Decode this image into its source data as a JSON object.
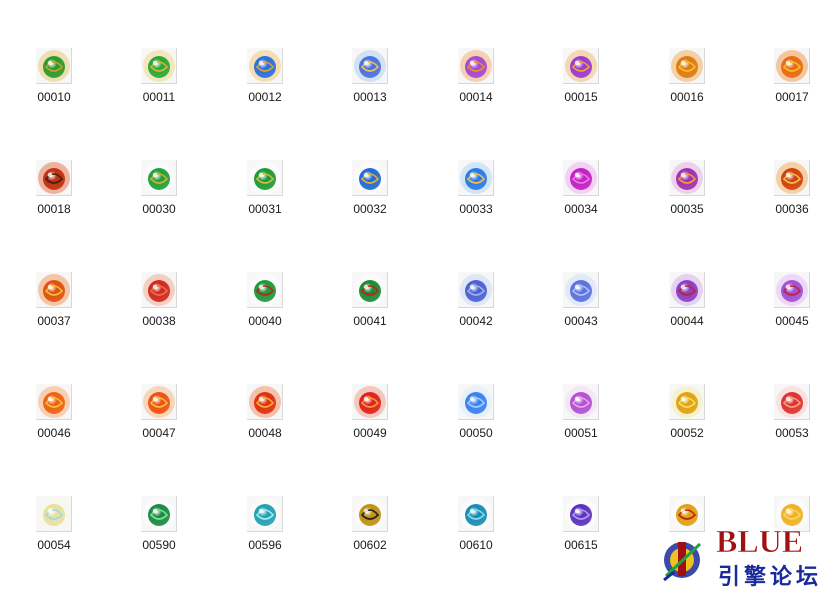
{
  "files": [
    {
      "name": "00010",
      "icon": "green-scarab-orb-icon",
      "c1": "#2a9a2a",
      "c2": "#c9a030",
      "glow": "#e0c060"
    },
    {
      "name": "00011",
      "icon": "green-gold-orb-icon",
      "c1": "#26a83a",
      "c2": "#e0b030",
      "glow": "#f0d070"
    },
    {
      "name": "00012",
      "icon": "blue-winged-orb-icon",
      "c1": "#2a6ee0",
      "c2": "#e0a030",
      "glow": "#f0c060"
    },
    {
      "name": "00013",
      "icon": "blue-winged-orb-icon",
      "c1": "#4a70e0",
      "c2": "#f0c050",
      "glow": "#a0c8f0"
    },
    {
      "name": "00014",
      "icon": "violet-flame-orb-icon",
      "c1": "#a04ad0",
      "c2": "#f08a30",
      "glow": "#f6a060"
    },
    {
      "name": "00015",
      "icon": "purple-flame-orb-icon",
      "c1": "#9a3ad0",
      "c2": "#f0a030",
      "glow": "#f0b060"
    },
    {
      "name": "00016",
      "icon": "gold-sun-orb-icon",
      "c1": "#e07a10",
      "c2": "#f6c030",
      "glow": "#f0a040"
    },
    {
      "name": "00017",
      "icon": "gold-sun-orb-icon",
      "c1": "#e86a10",
      "c2": "#f6c030",
      "glow": "#f08a30"
    },
    {
      "name": "00018",
      "icon": "dark-flame-orb-icon",
      "c1": "#c03010",
      "c2": "#402010",
      "glow": "#e06030"
    },
    {
      "name": "00030",
      "icon": "green-orb-icon",
      "c1": "#1ea03a",
      "c2": "#d0b030",
      "glow": "#ffffff"
    },
    {
      "name": "00031",
      "icon": "green-orb-icon",
      "c1": "#1c9a36",
      "c2": "#d8b840",
      "glow": "#ffffff"
    },
    {
      "name": "00032",
      "icon": "blue-orb-icon",
      "c1": "#1e6ad8",
      "c2": "#e0b030",
      "glow": "#ffffff"
    },
    {
      "name": "00033",
      "icon": "blue-swirl-orb-icon",
      "c1": "#2a7ae6",
      "c2": "#f0c050",
      "glow": "#a0d0f6"
    },
    {
      "name": "00034",
      "icon": "magenta-orb-icon",
      "c1": "#c020c0",
      "c2": "#f070f0",
      "glow": "#f0a0f0"
    },
    {
      "name": "00035",
      "icon": "purple-dotted-orb-icon",
      "c1": "#a030b0",
      "c2": "#f0a030",
      "glow": "#e0a0e0"
    },
    {
      "name": "00036",
      "icon": "orange-flame-orb-icon",
      "c1": "#d04010",
      "c2": "#f0c040",
      "glow": "#f0a040"
    },
    {
      "name": "00037",
      "icon": "fire-orb-icon",
      "c1": "#e05010",
      "c2": "#f6c030",
      "glow": "#f08a40"
    },
    {
      "name": "00038",
      "icon": "red-flame-orb-icon",
      "c1": "#d02820",
      "c2": "#f07040",
      "glow": "#f0a080"
    },
    {
      "name": "00040",
      "icon": "green-jade-pendant-icon",
      "c1": "#1a9a3a",
      "c2": "#c02020",
      "glow": "#ffffff"
    },
    {
      "name": "00041",
      "icon": "green-jade-ring-icon",
      "c1": "#1a8a30",
      "c2": "#c02020",
      "glow": "#ffffff"
    },
    {
      "name": "00042",
      "icon": "blue-crystal-icon",
      "c1": "#4a60d0",
      "c2": "#a0b0f0",
      "glow": "#c0d0f6"
    },
    {
      "name": "00043",
      "icon": "blue-crystal-icon",
      "c1": "#5a70e0",
      "c2": "#b0c0f6",
      "glow": "#c8d8f8"
    },
    {
      "name": "00044",
      "icon": "purple-crystal-icon",
      "c1": "#8a40c0",
      "c2": "#c02040",
      "glow": "#d0a0f0"
    },
    {
      "name": "00045",
      "icon": "violet-crystal-icon",
      "c1": "#a050d0",
      "c2": "#c02040",
      "glow": "#e0b0f6"
    },
    {
      "name": "00046",
      "icon": "orange-flame-orb-icon",
      "c1": "#f06010",
      "c2": "#f6c040",
      "glow": "#f6a060"
    },
    {
      "name": "00047",
      "icon": "orange-flame-orb-icon",
      "c1": "#f05010",
      "c2": "#f6c040",
      "glow": "#f6b070"
    },
    {
      "name": "00048",
      "icon": "red-sun-orb-icon",
      "c1": "#e03010",
      "c2": "#f6b030",
      "glow": "#f08050"
    },
    {
      "name": "00049",
      "icon": "red-gem-orb-icon",
      "c1": "#e02020",
      "c2": "#f0a030",
      "glow": "#f09070"
    },
    {
      "name": "00050",
      "icon": "blue-lotus-icon",
      "c1": "#3a80f0",
      "c2": "#a0d0ff",
      "glow": "#d0e8ff"
    },
    {
      "name": "00051",
      "icon": "violet-lotus-icon",
      "c1": "#b050d0",
      "c2": "#f0a0f0",
      "glow": "#f0d0f6"
    },
    {
      "name": "00052",
      "icon": "gold-lotus-icon",
      "c1": "#e0a010",
      "c2": "#f6e060",
      "glow": "#f8e8a0"
    },
    {
      "name": "00053",
      "icon": "red-lotus-icon",
      "c1": "#e03030",
      "c2": "#f6a080",
      "glow": "#f8c8c0"
    },
    {
      "name": "00054",
      "icon": "white-lotus-icon",
      "c1": "#e8e0a0",
      "c2": "#a0d8e0",
      "glow": "#f6f6e0"
    },
    {
      "name": "00590",
      "icon": "green-rune-stone-icon",
      "c1": "#1a8a40",
      "c2": "#80e0a0",
      "glow": "#ffffff"
    },
    {
      "name": "00596",
      "icon": "teal-rune-gem-icon",
      "c1": "#20a0b0",
      "c2": "#a0f0f0",
      "glow": "#ffffff"
    },
    {
      "name": "00602",
      "icon": "gold-rune-stone-icon",
      "c1": "#c09010",
      "c2": "#202020",
      "glow": "#ffffff"
    },
    {
      "name": "00610",
      "icon": "teal-crystal-shard-icon",
      "c1": "#1a8ab0",
      "c2": "#80e0f0",
      "glow": "#ffffff"
    },
    {
      "name": "00615",
      "icon": "violet-crystal-shard-icon",
      "c1": "#5a30c0",
      "c2": "#b0a0f0",
      "glow": "#ffffff"
    },
    {
      "name": "",
      "icon": "gold-crescent-gem-icon",
      "c1": "#e0a010",
      "c2": "#c02010",
      "glow": "#ffffff"
    },
    {
      "name": "",
      "icon": "gold-ingot-icon",
      "c1": "#f0b020",
      "c2": "#f6d860",
      "glow": "#ffffff"
    }
  ],
  "watermark": {
    "title": "BLUE",
    "subtitle": "引擎论坛",
    "colors": {
      "title": "#a01010",
      "subtitle": "#1a2a9a"
    }
  }
}
